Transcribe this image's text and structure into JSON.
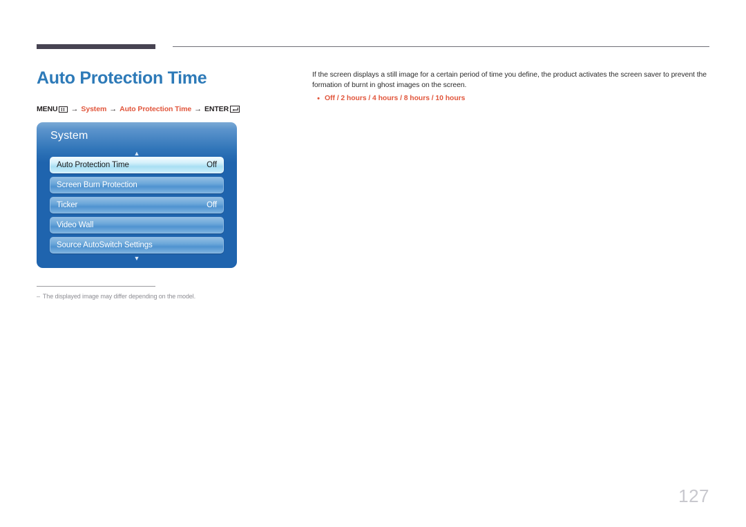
{
  "page": {
    "title": "Auto Protection Time",
    "number": "127",
    "title_color": "#2d7ab8",
    "accent_color": "#e1563c",
    "rule_color": "#474352"
  },
  "breadcrumb": {
    "menu_label": "MENU",
    "menu_icon": "menu-grid-icon",
    "arrow": "→",
    "step_system": "System",
    "step_item": "Auto Protection Time",
    "enter_label": "ENTER",
    "enter_icon": "enter-return-icon"
  },
  "osd": {
    "title": "System",
    "scroll_up_icon": "chevron-up-icon",
    "scroll_down_icon": "chevron-down-icon",
    "rows": [
      {
        "label": "Auto Protection Time",
        "value": "Off",
        "selected": true
      },
      {
        "label": "Screen Burn Protection",
        "value": "",
        "selected": false
      },
      {
        "label": "Ticker",
        "value": "Off",
        "selected": false
      },
      {
        "label": "Video Wall",
        "value": "",
        "selected": false
      },
      {
        "label": "Source AutoSwitch Settings",
        "value": "",
        "selected": false
      }
    ]
  },
  "footnote": {
    "dash": "–",
    "text": "The displayed image may differ depending on the model."
  },
  "description": {
    "paragraph": "If the screen displays a still image for a certain period of time you define, the product activates the screen saver to prevent the formation of burnt in ghost images on the screen.",
    "bullets": [
      "Off / 2 hours / 4 hours / 8 hours / 10 hours"
    ]
  }
}
